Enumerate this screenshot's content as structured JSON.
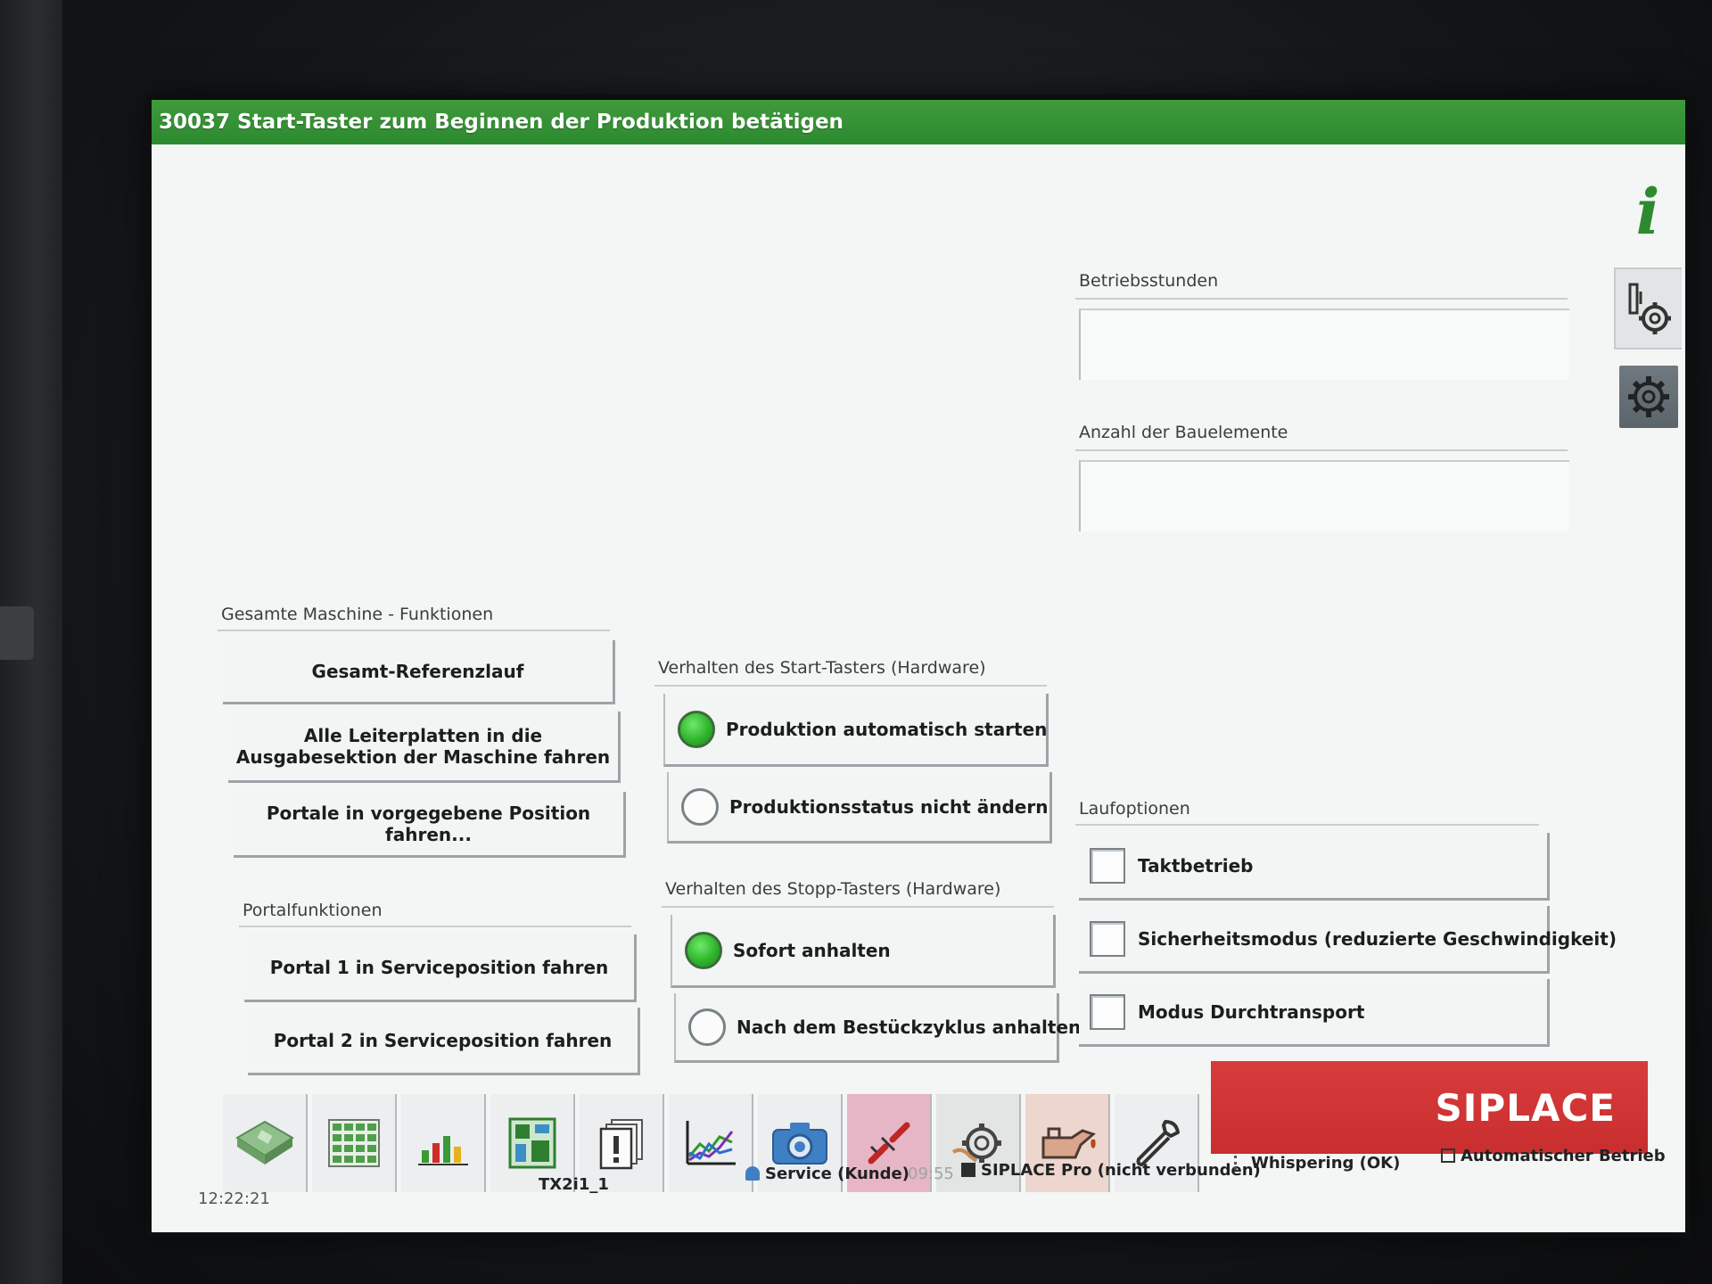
{
  "window": {
    "title": "30037 Start-Taster zum Beginnen der Produktion betätigen"
  },
  "info_panel": {
    "betriebsstunden_label": "Betriebsstunden",
    "betriebsstunden_value": "",
    "bauelemente_label": "Anzahl der Bauelemente",
    "bauelemente_value": ""
  },
  "machine_functions": {
    "label": "Gesamte Maschine - Funktionen",
    "buttons": [
      "Gesamt-Referenzlauf",
      "Alle Leiterplatten in die\nAusgabesektion der Maschine fahren",
      "Portale in vorgegebene Position fahren..."
    ]
  },
  "portal_functions": {
    "label": "Portalfunktionen",
    "buttons": [
      "Portal 1 in Serviceposition fahren",
      "Portal 2 in Serviceposition fahren"
    ]
  },
  "start_button_behavior": {
    "label": "Verhalten des Start-Tasters (Hardware)",
    "options": [
      {
        "label": "Produktion automatisch starten",
        "selected": true
      },
      {
        "label": "Produktionsstatus nicht ändern",
        "selected": false
      }
    ]
  },
  "stop_button_behavior": {
    "label": "Verhalten des Stopp-Tasters (Hardware)",
    "options": [
      {
        "label": "Sofort anhalten",
        "selected": true
      },
      {
        "label": "Nach dem Bestückzyklus anhalten",
        "selected": false
      }
    ]
  },
  "run_options": {
    "label": "Laufoptionen",
    "options": [
      {
        "label": "Taktbetrieb",
        "checked": false
      },
      {
        "label": "Sicherheitsmodus (reduzierte Geschwindigkeit)",
        "checked": false
      },
      {
        "label": "Modus Durchtransport",
        "checked": false
      }
    ]
  },
  "toolbar": {
    "icons": [
      "board-icon",
      "grid-icon",
      "bar-chart-icon",
      "layout-icon",
      "alert-documents-icon",
      "line-chart-icon",
      "camera-icon",
      "broken-link-icon",
      "gear-hand-icon",
      "oil-can-icon",
      "wrench-icon"
    ],
    "brand": "SIPLACE"
  },
  "status_bar": {
    "clock": "12:22:21",
    "machine_name": "TX2i1_1",
    "user": "Service (Kunde)",
    "user_time": "09:55",
    "connection": "SIPLACE Pro (nicht verbunden)",
    "whisper": "Whispering (OK)",
    "mode": "Automatischer Betrieb"
  },
  "colors": {
    "title_green": "#2c8a2f",
    "radio_green": "#2fb52d",
    "siplace_red": "#c92e2e"
  }
}
